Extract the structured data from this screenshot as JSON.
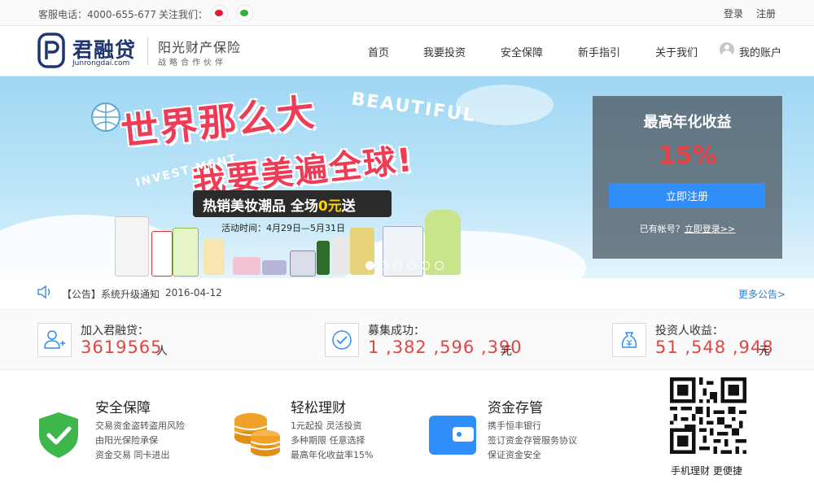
{
  "topbar": {
    "phone": "客服电话：4000-655-677",
    "follow": "关注我们：",
    "login": "登录",
    "register": "注册"
  },
  "header": {
    "logo_name": "君融贷",
    "logo_url": "Junrongdai.com",
    "partner_name": "阳光财产保险",
    "partner_sub": "战略合作伙伴",
    "nav": [
      "首页",
      "我要投资",
      "安全保障",
      "新手指引",
      "关于我们"
    ],
    "account": "我的账户"
  },
  "banner": {
    "title1": "世界那么大",
    "title2": "我要美遍全球!",
    "beautiful": "BEAUTIFUL",
    "invest": "INVEST MENT",
    "ribbon_prefix": "热销美妆潮品 全场",
    "ribbon_zero": "0元",
    "ribbon_suffix": "送",
    "date": "活动时间：4月29日—5月31日",
    "slide_count": 6,
    "active_slide": 1
  },
  "yield_box": {
    "label": "最高年化收益",
    "value": "15%",
    "button": "立即注册",
    "login_prefix": "已有帐号？",
    "login_link": "立即登录>>"
  },
  "notice": {
    "text": "【公告】系统升级通知",
    "date": "2016-04-12",
    "more": "更多公告>"
  },
  "stats": [
    {
      "label": "加入君融贷：",
      "value": "3619565",
      "unit": "人"
    },
    {
      "label": "募集成功：",
      "value": "1 ,382 ,596 ,390",
      "unit": "元"
    },
    {
      "label": "投资人收益：",
      "value": "51 ,548 ,948",
      "unit": "元"
    }
  ],
  "features": [
    {
      "title": "安全保障",
      "lines": [
        "交易资金盗转盗用风险",
        "由阳光保险承保",
        "资金交易 同卡进出"
      ]
    },
    {
      "title": "轻松理财",
      "lines": [
        "1元起投 灵活投资",
        "多种期限 任意选择",
        "最高年化收益率15%"
      ]
    },
    {
      "title": "资金存管",
      "lines": [
        "携手恒丰银行",
        "签订资金存管服务协议",
        "保证资金安全"
      ]
    }
  ],
  "qr": {
    "caption": "手机理财 更便捷"
  },
  "colors": {
    "brand": "#1e3570",
    "accent": "#2f8ef7",
    "highlight": "#e04545",
    "shield": "#3fb64c",
    "coins": "#f0a12a",
    "wallet": "#2f8ef7"
  }
}
